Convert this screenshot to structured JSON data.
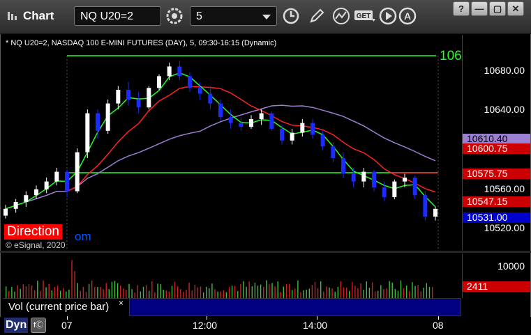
{
  "window": {
    "title": "Chart",
    "symbol_value": "NQ U20=2",
    "interval_value": "5",
    "window_buttons": [
      "?",
      "—",
      "▢",
      "✕"
    ]
  },
  "toolbar": {
    "icons": [
      "settings-gear-icon",
      "clock-icon",
      "pencil-icon",
      "study-icon",
      "get-icon",
      "play-icon",
      "font-icon"
    ],
    "get_label": "GET"
  },
  "chart": {
    "legend": "* NQ U20=2, NASDAQ 100 E-MINI FUTURES (DAY), 5, 09:30-16:15 (Dynamic)",
    "level_label": "106",
    "direction_label": "Direction",
    "om_text": "om",
    "copyright": "© eSignal, 2020",
    "price_axis": [
      "10680.00",
      "10640.00",
      "10560.00",
      "10520.00"
    ],
    "price_tags": [
      {
        "text": "10610.40",
        "bg": "#9b7fd0",
        "color": "#000000"
      },
      {
        "text": "10600.75",
        "bg": "#cc0000",
        "color": "#ffffff"
      },
      {
        "text": "10575.75",
        "bg": "#cc0000",
        "color": "#ffffff"
      },
      {
        "text": "10547.15",
        "bg": "#cc0000",
        "color": "#ffffff"
      },
      {
        "text": "10531.00",
        "bg": "#0000cc",
        "color": "#ffffff"
      }
    ],
    "time_labels": [
      "07",
      "12:00",
      "14:00",
      "08"
    ],
    "colors": {
      "up": "#ffffff",
      "down": "#1a2cff",
      "fast_ma": "#22ff22",
      "slow_ma": "#ff2222",
      "vwap": "#9b7fd0"
    }
  },
  "volume": {
    "title": "Vol (current price bar)",
    "close_label": "×",
    "axis_label": "10000",
    "tag": "2411"
  },
  "status": {
    "dyn_label": "Dyn",
    "fx_label": "fⒸ"
  },
  "chart_data": {
    "type": "candlestick",
    "series": [
      {
        "name": "NQ U20=2",
        "ohlc_estimated": [
          [
            10531,
            10542,
            10528,
            10538
          ],
          [
            10538,
            10548,
            10534,
            10545
          ],
          [
            10545,
            10556,
            10540,
            10552
          ],
          [
            10552,
            10562,
            10548,
            10558
          ],
          [
            10558,
            10570,
            10554,
            10566
          ],
          [
            10566,
            10580,
            10562,
            10576
          ],
          [
            10576,
            10578,
            10550,
            10556
          ],
          [
            10556,
            10600,
            10554,
            10596
          ],
          [
            10596,
            10640,
            10590,
            10636
          ],
          [
            10636,
            10640,
            10610,
            10618
          ],
          [
            10618,
            10650,
            10615,
            10646
          ],
          [
            10646,
            10664,
            10640,
            10660
          ],
          [
            10660,
            10668,
            10644,
            10650
          ],
          [
            10650,
            10658,
            10636,
            10642
          ],
          [
            10642,
            10664,
            10640,
            10662
          ],
          [
            10662,
            10676,
            10660,
            10674
          ],
          [
            10674,
            10688,
            10670,
            10684
          ],
          [
            10684,
            10690,
            10670,
            10674
          ],
          [
            10674,
            10678,
            10658,
            10662
          ],
          [
            10662,
            10668,
            10650,
            10656
          ],
          [
            10656,
            10664,
            10640,
            10646
          ],
          [
            10646,
            10650,
            10628,
            10632
          ],
          [
            10632,
            10640,
            10620,
            10626
          ],
          [
            10626,
            10632,
            10618,
            10622
          ],
          [
            10622,
            10634,
            10620,
            10630
          ],
          [
            10630,
            10640,
            10624,
            10636
          ],
          [
            10636,
            10638,
            10618,
            10620
          ],
          [
            10620,
            10624,
            10604,
            10608
          ],
          [
            10608,
            10620,
            10604,
            10616
          ],
          [
            10616,
            10630,
            10612,
            10626
          ],
          [
            10626,
            10630,
            10610,
            10614
          ],
          [
            10614,
            10618,
            10598,
            10602
          ],
          [
            10602,
            10606,
            10586,
            10590
          ],
          [
            10590,
            10596,
            10570,
            10574
          ],
          [
            10574,
            10580,
            10560,
            10566
          ],
          [
            10566,
            10580,
            10560,
            10576
          ],
          [
            10576,
            10578,
            10556,
            10560
          ],
          [
            10560,
            10566,
            10546,
            10550
          ],
          [
            10550,
            10568,
            10548,
            10566
          ],
          [
            10566,
            10574,
            10560,
            10570
          ],
          [
            10570,
            10572,
            10548,
            10552
          ],
          [
            10552,
            10556,
            10526,
            10530
          ],
          [
            10530,
            10540,
            10526,
            10538
          ]
        ]
      }
    ],
    "ma_fast_label": "Green MA",
    "ma_slow_label": "Red MA",
    "vwap_label": "VWAP"
  }
}
